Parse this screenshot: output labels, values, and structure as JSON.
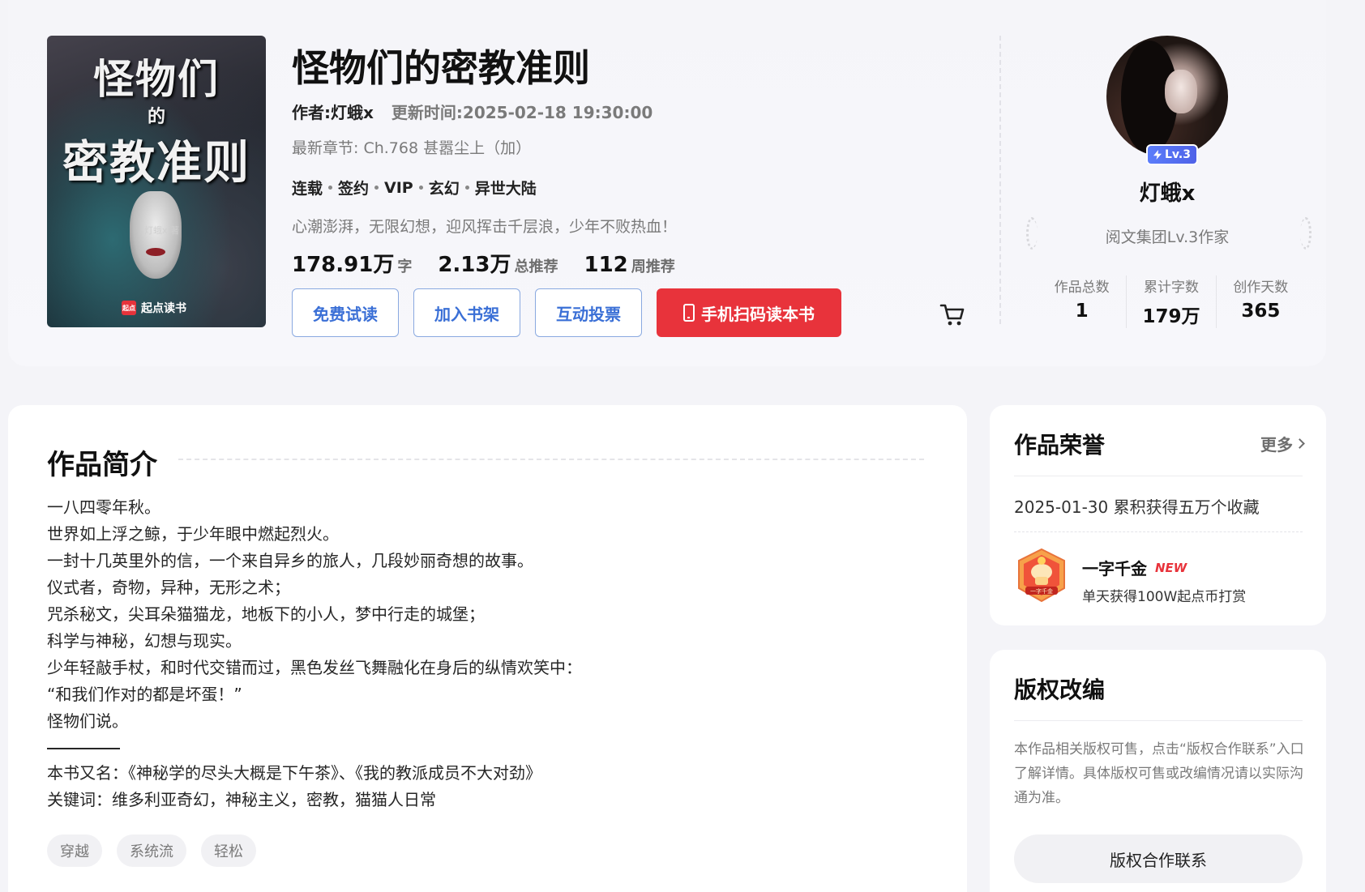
{
  "book": {
    "cover": {
      "title_line1": "怪物们",
      "title_de": "的",
      "title_line2": "密教准则",
      "author_tag": "灯蛾x 著",
      "brand": "起点读书",
      "brand_logo": "起点"
    },
    "title": "怪物们的密教准则",
    "author_label": "作者:灯蛾x",
    "update_label": "更新时间:2025-02-18 19:30:00",
    "latest_chapter": "最新章节: Ch.768 甚嚣尘上（加）",
    "tags": [
      "连载",
      "签约",
      "VIP",
      "玄幻",
      "异世大陆"
    ],
    "slogan": "心潮澎湃，无限幻想，迎风挥击千层浪，少年不败热血！",
    "stats": [
      {
        "num": "178.91万",
        "unit": "字"
      },
      {
        "num": "2.13万",
        "unit": "总推荐"
      },
      {
        "num": "112",
        "unit": "周推荐"
      }
    ],
    "buttons": {
      "free_read": "免费试读",
      "add_shelf": "加入书架",
      "vote": "互动投票",
      "scan_read": "手机扫码读本书"
    }
  },
  "author": {
    "level": "Lv.3",
    "name": "灯蛾x",
    "title": "阅文集团Lv.3作家",
    "stats": [
      {
        "label": "作品总数",
        "value": "1"
      },
      {
        "label": "累计字数",
        "value": "179万"
      },
      {
        "label": "创作天数",
        "value": "365"
      }
    ]
  },
  "intro": {
    "heading": "作品简介",
    "lines_before": [
      "一八四零年秋。",
      "世界如上浮之鲸，于少年眼中燃起烈火。",
      "一封十几英里外的信，一个来自异乡的旅人，几段妙丽奇想的故事。",
      "仪式者，奇物，异种，无形之术；",
      "咒杀秘文，尖耳朵猫猫龙，地板下的小人，梦中行走的城堡；",
      "科学与神秘，幻想与现实。",
      "少年轻敲手杖，和时代交错而过，黑色发丝飞舞融化在身后的纵情欢笑中：",
      "“和我们作对的都是坏蛋！”",
      "怪物们说。"
    ],
    "lines_after": [
      "本书又名：《神秘学的尽头大概是下午茶》、《我的教派成员不大对劲》",
      "关键词：维多利亚奇幻，神秘主义，密教，猫猫人日常"
    ],
    "chips": [
      "穿越",
      "系统流",
      "轻松"
    ]
  },
  "honor": {
    "heading": "作品荣誉",
    "more": "更多",
    "record": "2025-01-30 累积获得五万个收藏",
    "medal_name": "一字千金",
    "medal_new": "NEW",
    "medal_desc": "单天获得100W起点币打赏",
    "medal_ribbon": "一字千金"
  },
  "copyright": {
    "heading": "版权改编",
    "text": "本作品相关版权可售，点击“版权合作联系”入口了解详情。具体版权可售或改编情况请以实际沟通为准。",
    "button": "版权合作联系"
  },
  "colors": {
    "accent_red": "#e8333b",
    "accent_blue": "#3a6fd6",
    "level_blue": "#5b7dfa"
  }
}
